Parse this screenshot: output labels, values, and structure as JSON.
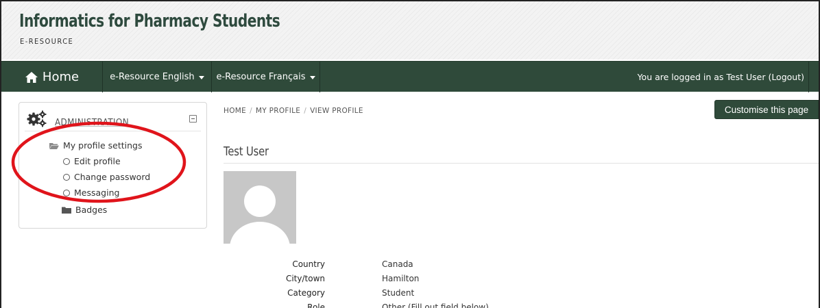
{
  "header": {
    "title": "Informatics for Pharmacy Students",
    "subtitle": "E-RESOURCE"
  },
  "navbar": {
    "home_label": "Home",
    "items": [
      {
        "label": "e-Resource English"
      },
      {
        "label": "e-Resource Français"
      }
    ],
    "login_text": "You are logged in as Test User (Logout)"
  },
  "admin": {
    "title": "ADMINISTRATION",
    "tree": {
      "profile_settings": "My profile settings",
      "edit_profile": "Edit profile",
      "change_password": "Change password",
      "messaging": "Messaging",
      "badges": "Badges"
    }
  },
  "breadcrumb": {
    "items": [
      "HOME",
      "MY PROFILE",
      "VIEW PROFILE"
    ],
    "separator": "/"
  },
  "customise_label": "Customise this page",
  "profile": {
    "name": "Test User",
    "fields": [
      {
        "label": "Country",
        "value": "Canada"
      },
      {
        "label": "City/town",
        "value": "Hamilton"
      },
      {
        "label": "Category",
        "value": "Student"
      },
      {
        "label": "Role",
        "value": "Other (Fill out field below)"
      }
    ]
  },
  "colors": {
    "navbar": "#2f4a3a",
    "title": "#2e4a3e",
    "annotation": "#e0141b",
    "avatar": "#c7c7c7"
  }
}
